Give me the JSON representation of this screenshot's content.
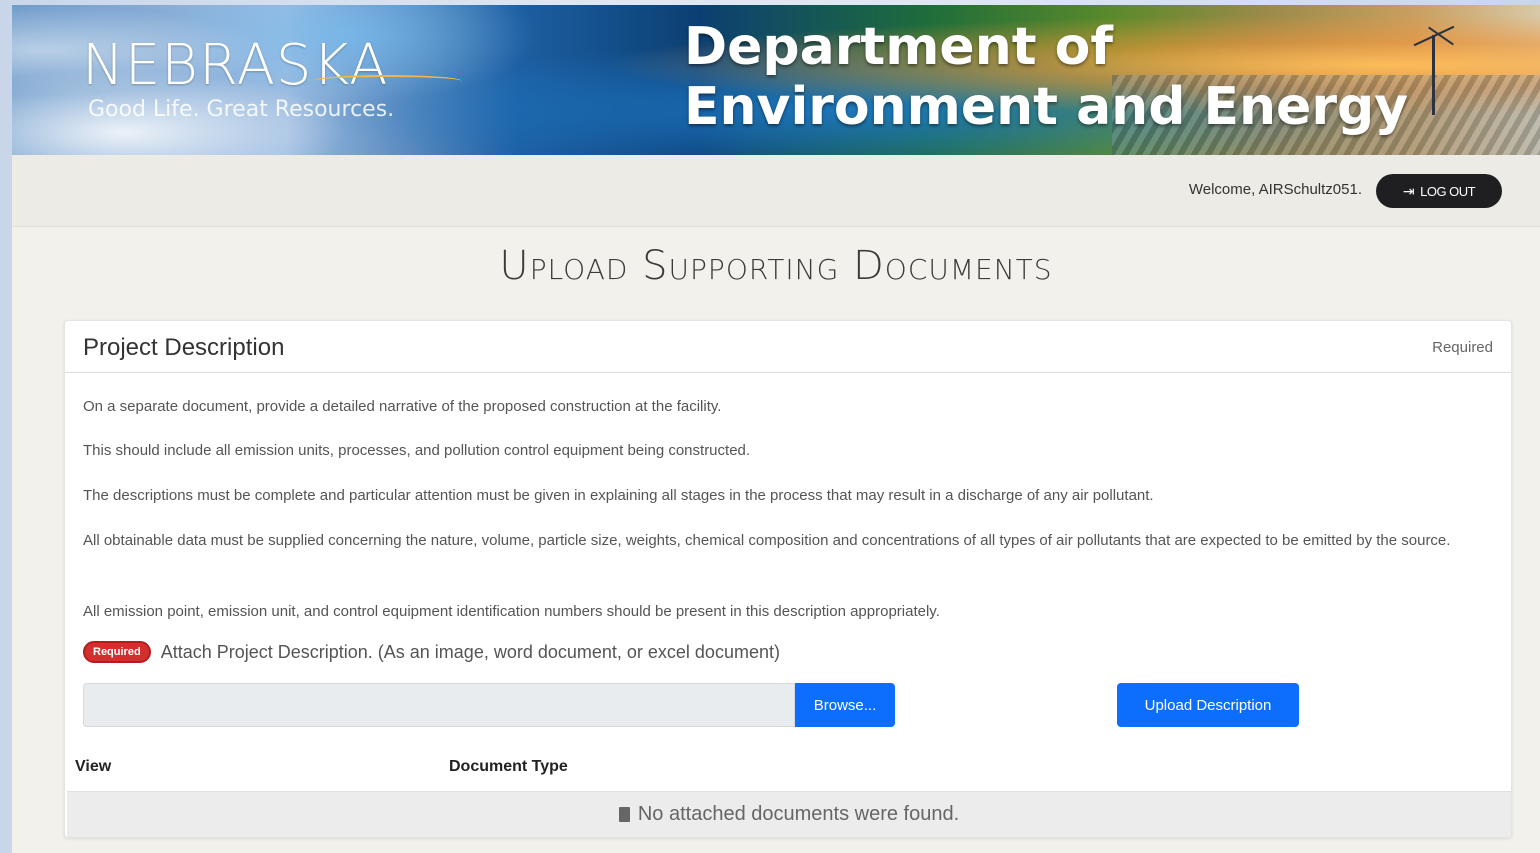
{
  "banner": {
    "brand": "NEBRASKA",
    "tagline": "Good Life. Great Resources.",
    "department_line1": "Department of",
    "department_line2": "Environment and Energy"
  },
  "userbar": {
    "welcome": "Welcome, AIRSchultz051.",
    "logout_label": "LOG OUT",
    "logout_icon": "logout-icon"
  },
  "page_title": "Upload Supporting Documents",
  "card": {
    "title": "Project Description",
    "required_label": "Required",
    "paragraphs": [
      "On a separate document, provide a detailed narrative of the proposed construction at the facility.",
      "This should include all emission units, processes, and pollution control equipment being constructed.",
      "The descriptions must be complete and particular attention must be given in explaining all stages in the process that may result in a discharge of any air pollutant.",
      "All obtainable data must be supplied concerning the nature, volume, particle size, weights, chemical composition and concentrations of all types of air pollutants that are expected to be emitted by the source.",
      "All emission point, emission unit, and control equipment identification numbers should be present in this description appropriately."
    ],
    "badge": "Required",
    "attach_label": "Attach Project Description. (As an image, word document, or excel document)",
    "file_input_value": "",
    "browse_label": "Browse...",
    "upload_label": "Upload Description",
    "table": {
      "headers": [
        "View",
        "Document Type"
      ],
      "empty_message": "No attached documents were found."
    }
  },
  "colors": {
    "primary_button": "#0d6efd",
    "badge_red": "#d32f2f",
    "logout_bg": "#1f1f22"
  }
}
